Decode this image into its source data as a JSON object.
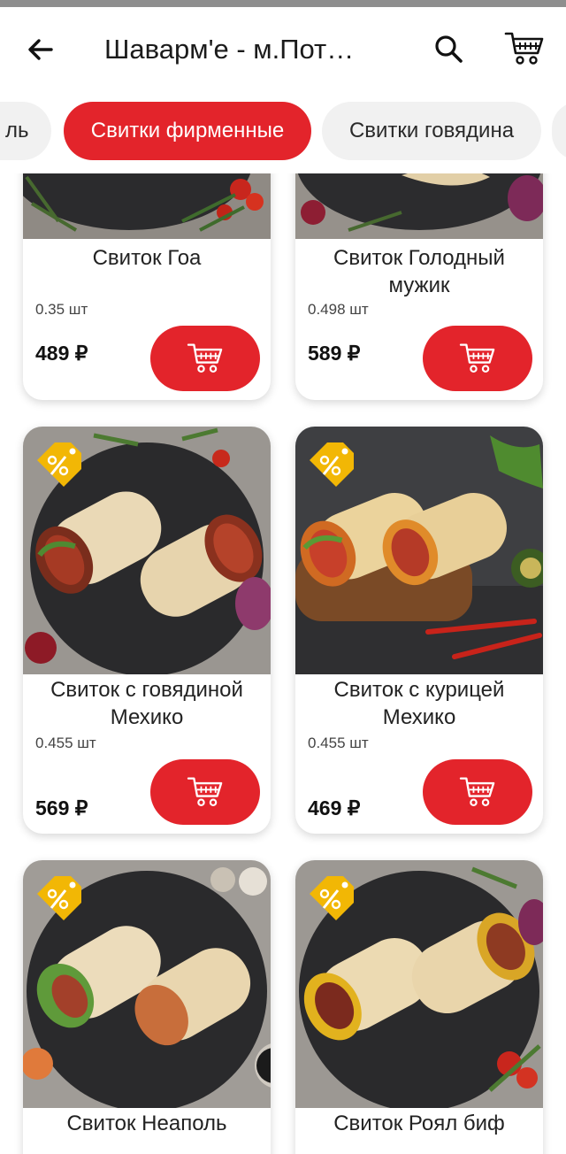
{
  "header": {
    "title": "Шаварм'е - м.Пот…"
  },
  "categories": [
    {
      "label": "ль",
      "active": false
    },
    {
      "label": "Свитки фирменные",
      "active": true
    },
    {
      "label": "Свитки говядина",
      "active": false
    }
  ],
  "products": [
    {
      "name": "Свиток Гоа",
      "weight": "0.35 шт",
      "price": "489 ₽",
      "discount": false
    },
    {
      "name": "Свиток Голодный мужик",
      "weight": "0.498 шт",
      "price": "589 ₽",
      "discount": false
    },
    {
      "name": "Свиток с говядиной Мехико",
      "weight": "0.455 шт",
      "price": "569 ₽",
      "discount": true
    },
    {
      "name": "Свиток с курицей Мехико",
      "weight": "0.455 шт",
      "price": "469 ₽",
      "discount": true
    },
    {
      "name": "Свиток Неаполь",
      "weight": "",
      "price": "",
      "discount": true
    },
    {
      "name": "Свиток Роял биф",
      "weight": "",
      "price": "",
      "discount": true
    }
  ],
  "icons": {
    "back": "arrow-left-icon",
    "search": "search-icon",
    "cart": "cart-icon",
    "add": "cart-icon",
    "discount": "percent-tag-icon"
  },
  "colors": {
    "accent": "#e3242b",
    "badge": "#f2b705",
    "chip_bg": "#f1f1f1"
  }
}
